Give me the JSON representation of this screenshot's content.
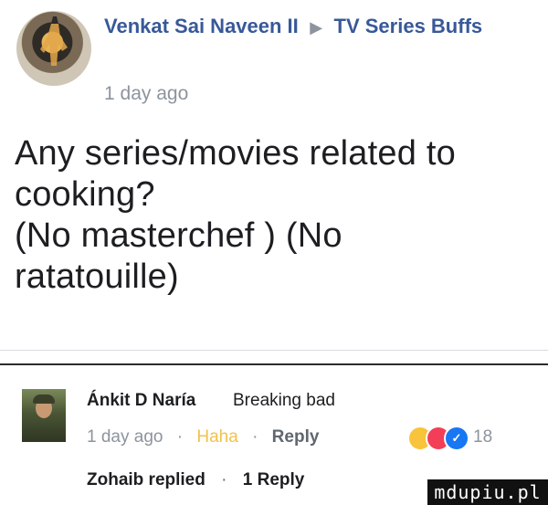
{
  "post": {
    "author": "Venkat Sai Naveen II",
    "group": "TV Series Buffs",
    "time": "1 day ago",
    "body_lines": [
      "Any series/movies related to",
      "cooking?",
      "(No masterchef ) (No",
      "ratatouille)"
    ]
  },
  "comment": {
    "author": "Ánkit D Naría",
    "text": "Breaking bad",
    "time": "1 day ago",
    "reaction_label": "Haha",
    "reply_label": "Reply",
    "reaction_count": "18",
    "reaction_icons": [
      "haha-icon",
      "love-icon",
      "like-icon"
    ],
    "replies": {
      "replier": "Zohaib replied",
      "count_label": "1 Reply"
    }
  },
  "watermark": "mdupiu.pl",
  "colors": {
    "link_blue": "#385898",
    "meta_gray": "#8d949e",
    "haha_yellow": "#f0c24b"
  }
}
